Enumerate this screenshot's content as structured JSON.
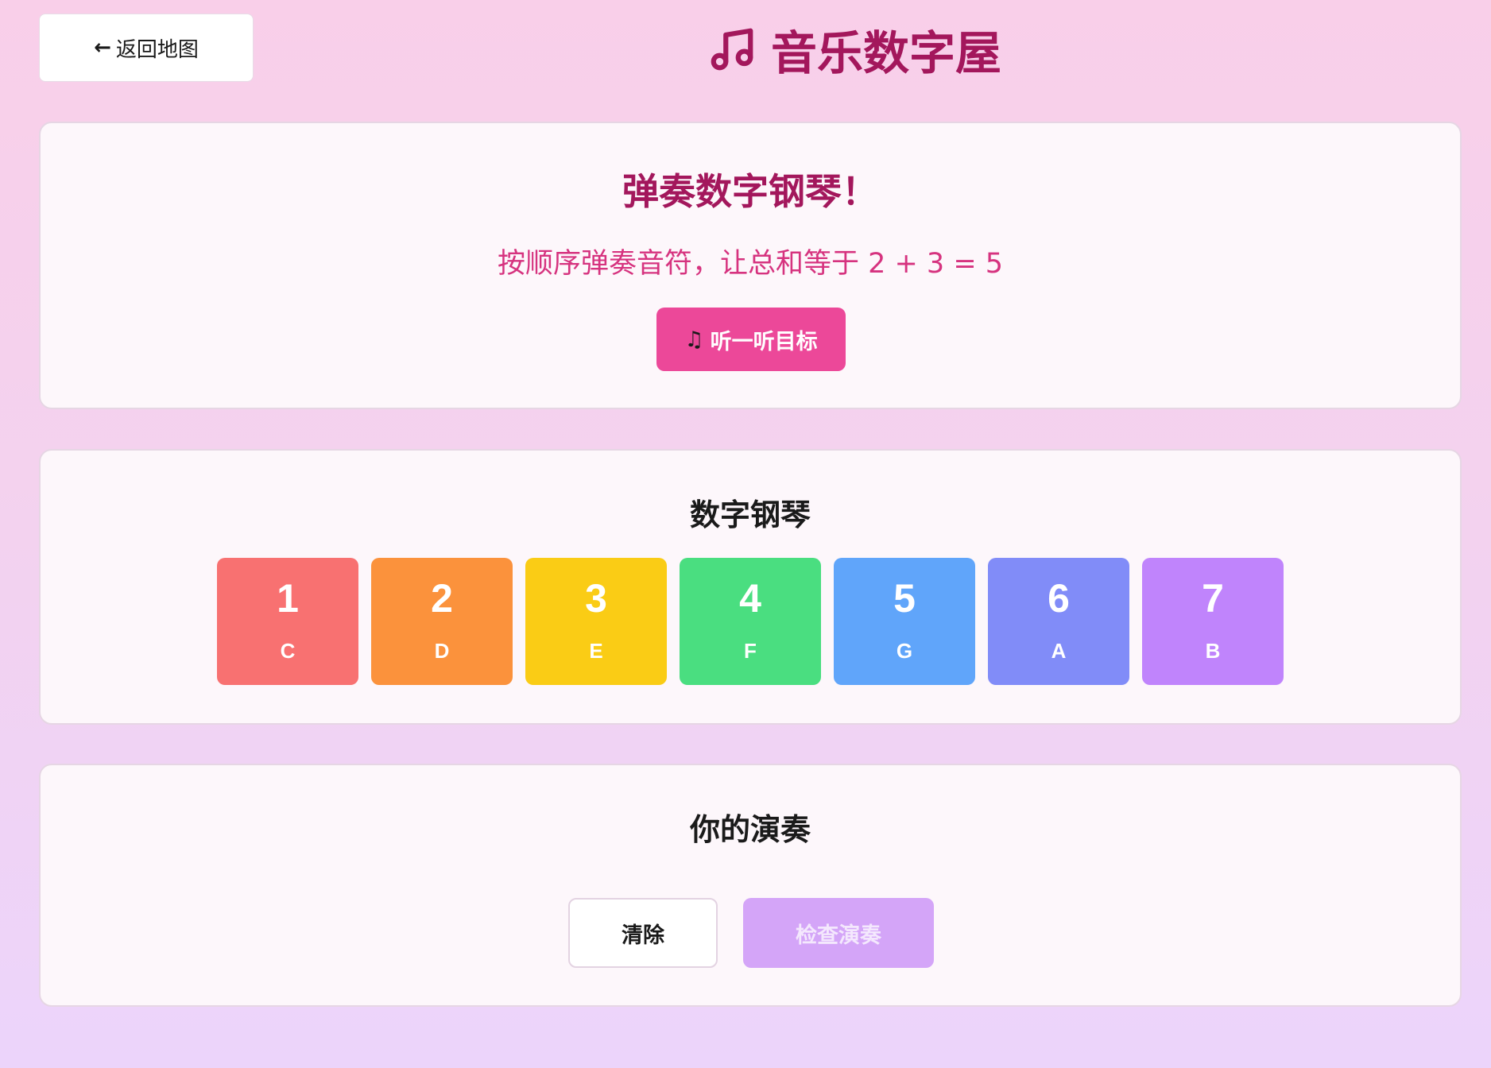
{
  "header": {
    "back_label": "返回地图",
    "title": "音乐数字屋",
    "title_icon": "music-notes-icon"
  },
  "target": {
    "heading": "弹奏数字钢琴！",
    "description": "按顺序弹奏音符，让总和等于 2 + 3 = 5",
    "listen_label": "听一听目标",
    "listen_icon": "music-note-icon"
  },
  "piano": {
    "heading": "数字钢琴",
    "keys": [
      {
        "number": "1",
        "note": "C",
        "color": "#f87171"
      },
      {
        "number": "2",
        "note": "D",
        "color": "#fb923c"
      },
      {
        "number": "3",
        "note": "E",
        "color": "#facc15"
      },
      {
        "number": "4",
        "note": "F",
        "color": "#4ade80"
      },
      {
        "number": "5",
        "note": "G",
        "color": "#60a5fa"
      },
      {
        "number": "6",
        "note": "A",
        "color": "#818cf8"
      },
      {
        "number": "7",
        "note": "B",
        "color": "#c084fc"
      }
    ]
  },
  "performance": {
    "heading": "你的演奏",
    "clear_label": "清除",
    "check_label": "检查演奏"
  },
  "colors": {
    "title": "#a3175c",
    "accent": "#ec4899",
    "check_disabled": "#d4a5f8"
  }
}
